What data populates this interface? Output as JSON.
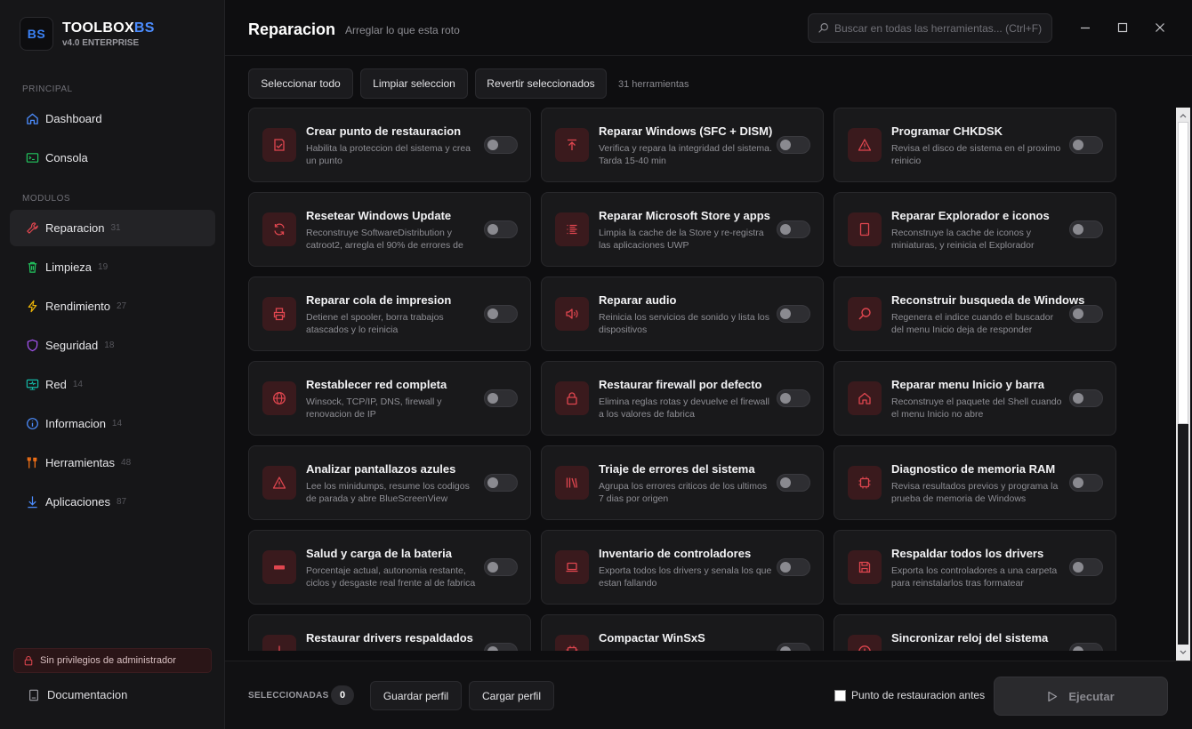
{
  "brand": {
    "logo": "BS",
    "name_main": "TOOLBOX",
    "name_accent": "BS",
    "version": "v4.0 ENTERPRISE"
  },
  "sidebar": {
    "section_principal": "PRINCIPAL",
    "section_modulos": "MODULOS",
    "principal": [
      {
        "label": "Dashboard",
        "icon": "home-icon"
      },
      {
        "label": "Consola",
        "icon": "terminal-icon"
      }
    ],
    "modulos": [
      {
        "label": "Reparacion",
        "count": "31",
        "icon": "wrench-icon",
        "active": true
      },
      {
        "label": "Limpieza",
        "count": "19",
        "icon": "trash-icon"
      },
      {
        "label": "Rendimiento",
        "count": "27",
        "icon": "bolt-icon"
      },
      {
        "label": "Seguridad",
        "count": "18",
        "icon": "shield-icon"
      },
      {
        "label": "Red",
        "count": "14",
        "icon": "monitor-icon"
      },
      {
        "label": "Informacion",
        "count": "14",
        "icon": "info-icon"
      },
      {
        "label": "Herramientas",
        "count": "48",
        "icon": "tools-icon"
      },
      {
        "label": "Aplicaciones",
        "count": "87",
        "icon": "download-icon"
      }
    ],
    "admin_badge": "Sin privilegios de administrador",
    "documentation": "Documentacion"
  },
  "header": {
    "title": "Reparacion",
    "subtitle": "Arreglar lo que esta roto",
    "search_placeholder": "Buscar en todas las herramientas... (Ctrl+F)"
  },
  "toolbar": {
    "select_all": "Seleccionar todo",
    "clear_selection": "Limpiar seleccion",
    "revert_selected": "Revertir seleccionados",
    "tool_count": "31 herramientas"
  },
  "tools": [
    {
      "title": "Crear punto de restauracion",
      "desc": "Habilita la proteccion del sistema y crea un punto",
      "icon": "restore-point-icon"
    },
    {
      "title": "Reparar Windows (SFC + DISM)",
      "desc": "Verifica y repara la integridad del sistema. Tarda 15-40 min",
      "icon": "upload-icon"
    },
    {
      "title": "Programar CHKDSK",
      "desc": "Revisa el disco de sistema en el proximo reinicio",
      "icon": "warning-icon"
    },
    {
      "title": "Resetear Windows Update",
      "desc": "Reconstruye SoftwareDistribution y catroot2, arregla el 90% de errores de update",
      "icon": "refresh-icon"
    },
    {
      "title": "Reparar Microsoft Store y apps",
      "desc": "Limpia la cache de la Store y re-registra las aplicaciones UWP",
      "icon": "list-icon"
    },
    {
      "title": "Reparar Explorador e iconos",
      "desc": "Reconstruye la cache de iconos y miniaturas, y reinicia el Explorador",
      "icon": "tablet-icon"
    },
    {
      "title": "Reparar cola de impresion",
      "desc": "Detiene el spooler, borra trabajos atascados y lo reinicia",
      "icon": "printer-icon"
    },
    {
      "title": "Reparar audio",
      "desc": "Reinicia los servicios de sonido y lista los dispositivos",
      "icon": "speaker-icon"
    },
    {
      "title": "Reconstruir busqueda de Windows",
      "desc": "Regenera el indice cuando el buscador del menu Inicio deja de responder",
      "icon": "search-icon"
    },
    {
      "title": "Restablecer red completa",
      "desc": "Winsock, TCP/IP, DNS, firewall y renovacion de IP",
      "icon": "globe-icon"
    },
    {
      "title": "Restaurar firewall por defecto",
      "desc": "Elimina reglas rotas y devuelve el firewall a los valores de fabrica",
      "icon": "lock-icon"
    },
    {
      "title": "Reparar menu Inicio y barra",
      "desc": "Reconstruye el paquete del Shell cuando el menu Inicio no abre",
      "icon": "home-icon"
    },
    {
      "title": "Analizar pantallazos azules",
      "desc": "Lee los minidumps, resume los codigos de parada y abre BlueScreenView",
      "icon": "warning-icon"
    },
    {
      "title": "Triaje de errores del sistema",
      "desc": "Agrupa los errores criticos de los ultimos 7 dias por origen",
      "icon": "books-icon"
    },
    {
      "title": "Diagnostico de memoria RAM",
      "desc": "Revisa resultados previos y programa la prueba de memoria de Windows",
      "icon": "chip-icon"
    },
    {
      "title": "Salud y carga de la bateria",
      "desc": "Porcentaje actual, autonomia restante, ciclos y desgaste real frente al de fabrica",
      "icon": "battery-icon"
    },
    {
      "title": "Inventario de controladores",
      "desc": "Exporta todos los drivers y senala los que estan fallando",
      "icon": "laptop-icon"
    },
    {
      "title": "Respaldar todos los drivers",
      "desc": "Exporta los controladores a una carpeta para reinstalarlos tras formatear",
      "icon": "save-icon"
    },
    {
      "title": "Restaurar drivers respaldados",
      "desc": "",
      "icon": "download-icon"
    },
    {
      "title": "Compactar WinSxS",
      "desc": "",
      "icon": "chip-icon"
    },
    {
      "title": "Sincronizar reloj del sistema",
      "desc": "",
      "icon": "clock-icon"
    }
  ],
  "footer": {
    "selected_label": "SELECCIONADAS",
    "selected_count": "0",
    "save_profile": "Guardar perfil",
    "load_profile": "Cargar perfil",
    "restore_point_before": "Punto de restauracion antes",
    "run": "Ejecutar"
  },
  "colors": {
    "accent_blue": "#4c8dff",
    "accent_red": "#e0464f",
    "background": "#0e0e10"
  }
}
